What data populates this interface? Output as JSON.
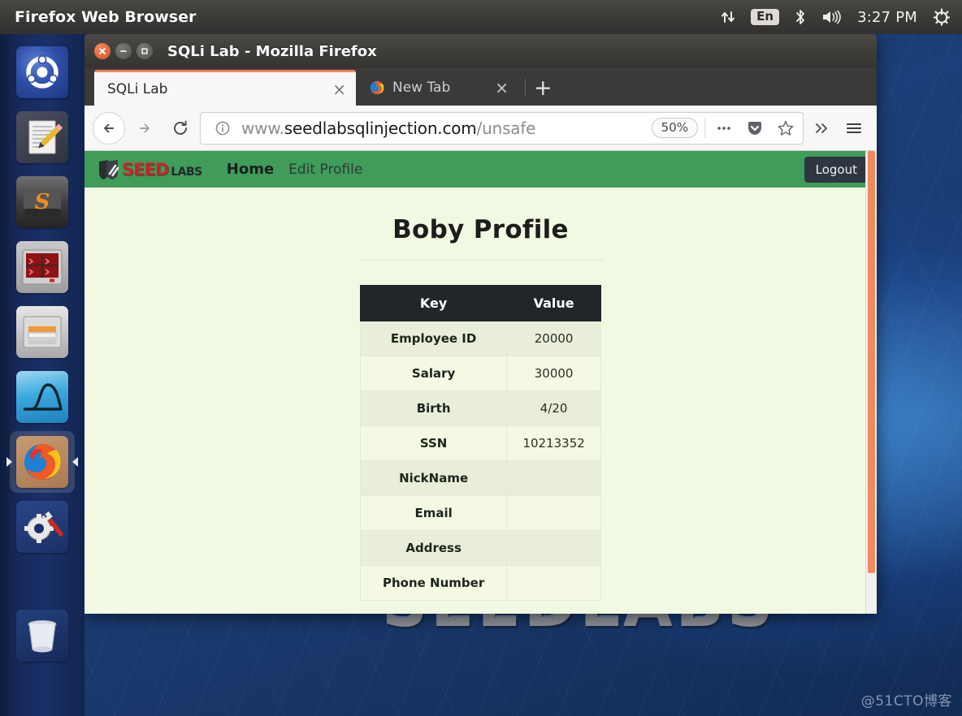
{
  "desktop": {
    "wallpaper_text": "SEEDLABS",
    "watermark": "@51CTO博客"
  },
  "top_panel": {
    "app_menu_title": "Firefox Web Browser",
    "keyboard_layout": "En",
    "clock": "3:27 PM",
    "icons": [
      "network-arrows-icon",
      "keyboard-layout-icon",
      "bluetooth-icon",
      "volume-icon",
      "system-menu-gear-icon"
    ]
  },
  "launcher": {
    "items": [
      {
        "name": "ubuntu-dash",
        "label": "Ubuntu Dash"
      },
      {
        "name": "text-editor",
        "label": "Text Editor"
      },
      {
        "name": "sublime-text",
        "label": "Sublime Text"
      },
      {
        "name": "terminal",
        "label": "Terminal"
      },
      {
        "name": "files",
        "label": "Files"
      },
      {
        "name": "wireshark",
        "label": "Wireshark"
      },
      {
        "name": "firefox",
        "label": "Firefox"
      },
      {
        "name": "system-settings",
        "label": "System Settings"
      },
      {
        "name": "trash",
        "label": "Trash"
      }
    ]
  },
  "browser": {
    "window_title": "SQLi Lab - Mozilla Firefox",
    "tabs": [
      {
        "label": "SQLi Lab",
        "active": true,
        "close_glyph": "×"
      },
      {
        "label": "New Tab",
        "active": false,
        "close_glyph": "×"
      }
    ],
    "new_tab_glyph": "+",
    "url": {
      "scheme_prefix": "www.",
      "host": "seedlabsqlinjection.com",
      "path": "/unsafe",
      "full": "www.seedlabsqlinjection.com/unsafe",
      "security_icon": "info-circle-icon"
    },
    "zoom_level": "50%",
    "toolbar_icons": [
      "back-icon",
      "forward-icon",
      "reload-icon",
      "page-actions-ellipsis-icon",
      "pocket-icon",
      "bookmark-star-icon",
      "overflow-chevrons-icon",
      "hamburger-menu-icon"
    ]
  },
  "page": {
    "brand": {
      "seed": "SEED",
      "labs": "LABS"
    },
    "nav_links": [
      {
        "label": "Home",
        "active": true
      },
      {
        "label": "Edit Profile",
        "active": false
      }
    ],
    "logout_label": "Logout",
    "heading": "Boby Profile",
    "table": {
      "columns": [
        "Key",
        "Value"
      ],
      "rows": [
        {
          "key": "Employee ID",
          "value": "20000"
        },
        {
          "key": "Salary",
          "value": "30000"
        },
        {
          "key": "Birth",
          "value": "4/20"
        },
        {
          "key": "SSN",
          "value": "10213352"
        },
        {
          "key": "NickName",
          "value": ""
        },
        {
          "key": "Email",
          "value": ""
        },
        {
          "key": "Address",
          "value": ""
        },
        {
          "key": "Phone Number",
          "value": ""
        }
      ]
    }
  },
  "colors": {
    "nav_green": "#3f9c5a",
    "page_bg": "#f2f9e2",
    "table_header_bg": "#222529",
    "row_odd": "#e9eeda",
    "row_even": "#f4f9e4",
    "accent_orange": "#f1845a",
    "logout_bg": "#2f3640"
  }
}
